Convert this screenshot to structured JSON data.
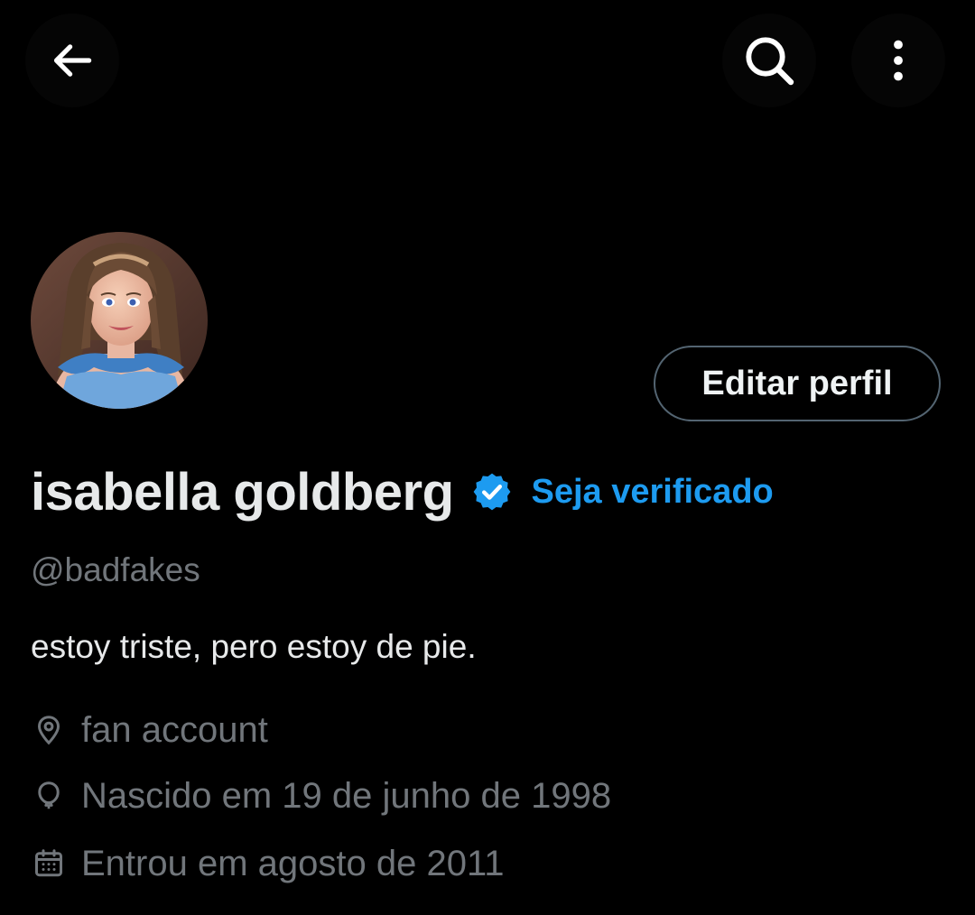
{
  "header": {
    "back_icon": "arrow-left-icon",
    "search_icon": "search-icon",
    "more_icon": "more-vertical-icon"
  },
  "profile": {
    "display_name": "isabella goldberg",
    "verified_icon": "verified-badge-icon",
    "get_verified_label": "Seja verificado",
    "handle": "@badfakes",
    "bio": "estoy triste, pero estoy de pie.",
    "edit_profile_label": "Editar perfil",
    "location": "fan account",
    "birthdate": "Nascido em 19 de junho de 1998",
    "joined": "Entrou em agosto de 2011"
  },
  "colors": {
    "background": "#000000",
    "accent": "#1d9bf0",
    "primary_text": "#e7e9ea",
    "secondary_text": "#71767b",
    "button_border": "#536471"
  }
}
